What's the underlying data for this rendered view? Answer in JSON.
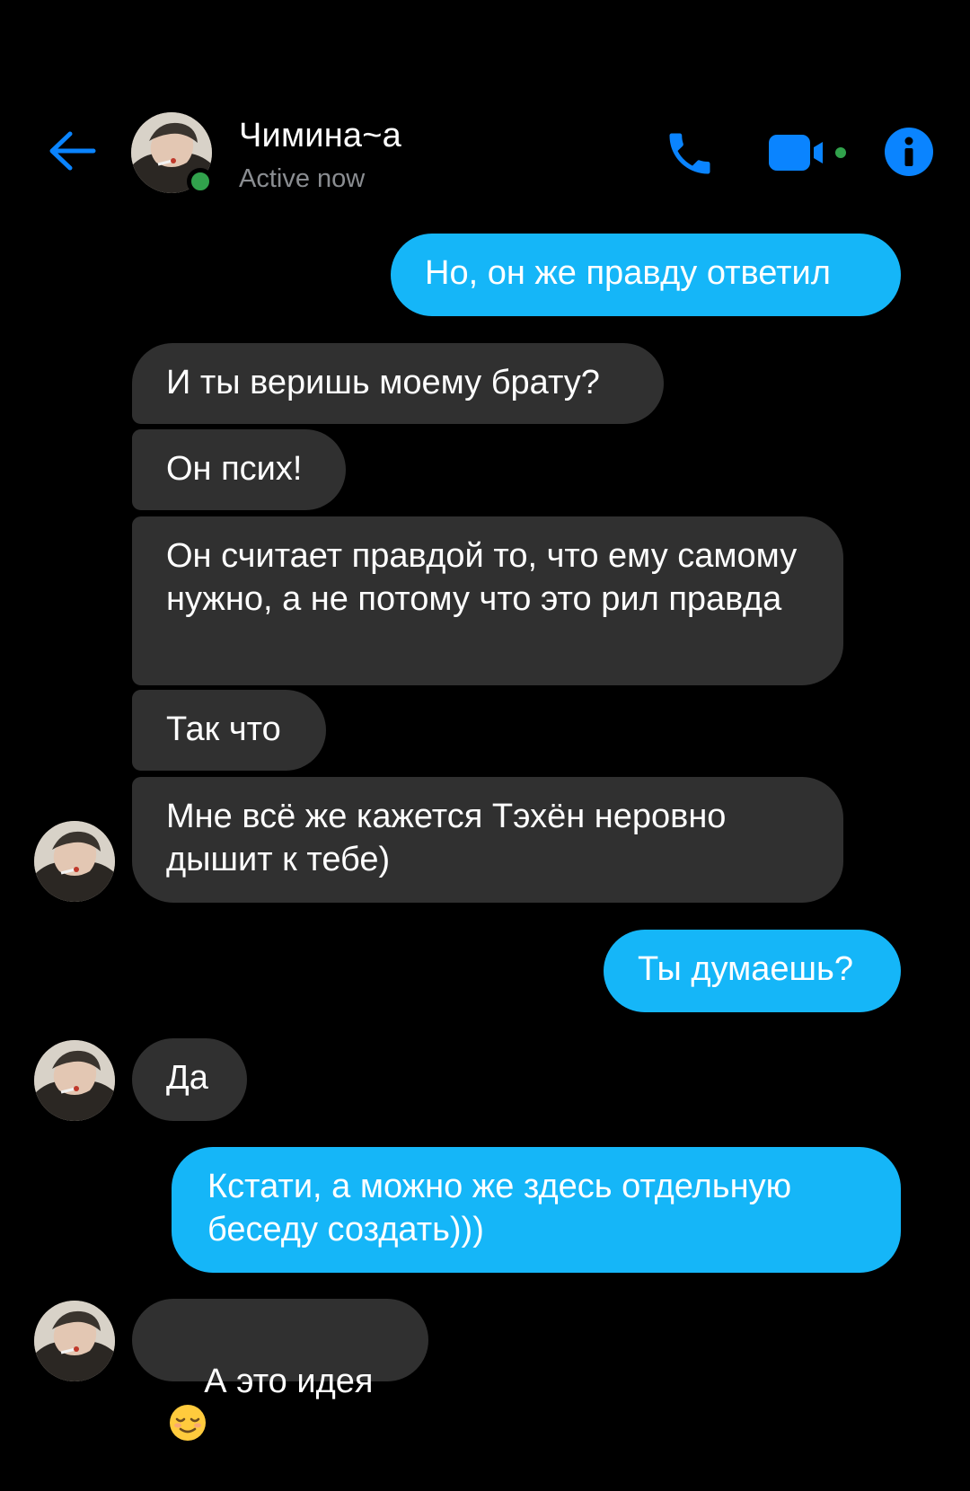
{
  "header": {
    "contact_name": "Чимина~а",
    "status": "Active now",
    "accent_color": "#0a84ff",
    "online_color": "#31a24c",
    "icons": {
      "back": "back-arrow-icon",
      "call": "phone-icon",
      "video": "video-camera-icon",
      "info": "info-icon"
    }
  },
  "theme": {
    "outgoing_bubble_color": "#15b6f8",
    "incoming_bubble_color": "#303030",
    "background": "#000000"
  },
  "messages": [
    {
      "direction": "out",
      "text": "Но, он же правду ответил"
    },
    {
      "direction": "in",
      "text": "И ты веришь моему брату?"
    },
    {
      "direction": "in",
      "text": "Он псих!"
    },
    {
      "direction": "in",
      "text": "Он считает правдой то, что ему самому нужно, а не потому что это рил правда"
    },
    {
      "direction": "in",
      "text": "Так что"
    },
    {
      "direction": "in",
      "text": "Мне всё же кажется Тэхён неровно дышит к тебе)"
    },
    {
      "direction": "out",
      "text": "Ты думаешь?"
    },
    {
      "direction": "in",
      "text": "Да"
    },
    {
      "direction": "out",
      "text": "Кстати, а можно же здесь отдельную беседу создать)))"
    },
    {
      "direction": "in",
      "text": "А это идея",
      "emoji": "relieved-face-emoji"
    }
  ]
}
